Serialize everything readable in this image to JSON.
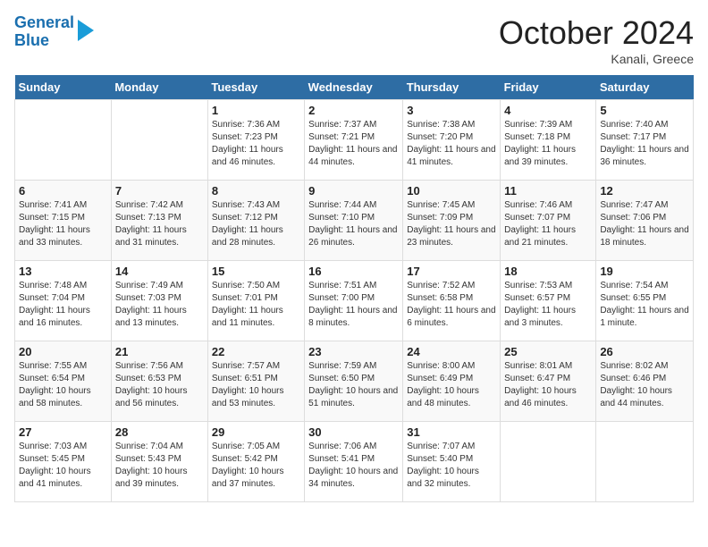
{
  "header": {
    "logo_line1": "General",
    "logo_line2": "Blue",
    "month": "October 2024",
    "location": "Kanali, Greece"
  },
  "weekdays": [
    "Sunday",
    "Monday",
    "Tuesday",
    "Wednesday",
    "Thursday",
    "Friday",
    "Saturday"
  ],
  "weeks": [
    [
      {
        "day": "",
        "info": ""
      },
      {
        "day": "",
        "info": ""
      },
      {
        "day": "1",
        "info": "Sunrise: 7:36 AM\nSunset: 7:23 PM\nDaylight: 11 hours and 46 minutes."
      },
      {
        "day": "2",
        "info": "Sunrise: 7:37 AM\nSunset: 7:21 PM\nDaylight: 11 hours and 44 minutes."
      },
      {
        "day": "3",
        "info": "Sunrise: 7:38 AM\nSunset: 7:20 PM\nDaylight: 11 hours and 41 minutes."
      },
      {
        "day": "4",
        "info": "Sunrise: 7:39 AM\nSunset: 7:18 PM\nDaylight: 11 hours and 39 minutes."
      },
      {
        "day": "5",
        "info": "Sunrise: 7:40 AM\nSunset: 7:17 PM\nDaylight: 11 hours and 36 minutes."
      }
    ],
    [
      {
        "day": "6",
        "info": "Sunrise: 7:41 AM\nSunset: 7:15 PM\nDaylight: 11 hours and 33 minutes."
      },
      {
        "day": "7",
        "info": "Sunrise: 7:42 AM\nSunset: 7:13 PM\nDaylight: 11 hours and 31 minutes."
      },
      {
        "day": "8",
        "info": "Sunrise: 7:43 AM\nSunset: 7:12 PM\nDaylight: 11 hours and 28 minutes."
      },
      {
        "day": "9",
        "info": "Sunrise: 7:44 AM\nSunset: 7:10 PM\nDaylight: 11 hours and 26 minutes."
      },
      {
        "day": "10",
        "info": "Sunrise: 7:45 AM\nSunset: 7:09 PM\nDaylight: 11 hours and 23 minutes."
      },
      {
        "day": "11",
        "info": "Sunrise: 7:46 AM\nSunset: 7:07 PM\nDaylight: 11 hours and 21 minutes."
      },
      {
        "day": "12",
        "info": "Sunrise: 7:47 AM\nSunset: 7:06 PM\nDaylight: 11 hours and 18 minutes."
      }
    ],
    [
      {
        "day": "13",
        "info": "Sunrise: 7:48 AM\nSunset: 7:04 PM\nDaylight: 11 hours and 16 minutes."
      },
      {
        "day": "14",
        "info": "Sunrise: 7:49 AM\nSunset: 7:03 PM\nDaylight: 11 hours and 13 minutes."
      },
      {
        "day": "15",
        "info": "Sunrise: 7:50 AM\nSunset: 7:01 PM\nDaylight: 11 hours and 11 minutes."
      },
      {
        "day": "16",
        "info": "Sunrise: 7:51 AM\nSunset: 7:00 PM\nDaylight: 11 hours and 8 minutes."
      },
      {
        "day": "17",
        "info": "Sunrise: 7:52 AM\nSunset: 6:58 PM\nDaylight: 11 hours and 6 minutes."
      },
      {
        "day": "18",
        "info": "Sunrise: 7:53 AM\nSunset: 6:57 PM\nDaylight: 11 hours and 3 minutes."
      },
      {
        "day": "19",
        "info": "Sunrise: 7:54 AM\nSunset: 6:55 PM\nDaylight: 11 hours and 1 minute."
      }
    ],
    [
      {
        "day": "20",
        "info": "Sunrise: 7:55 AM\nSunset: 6:54 PM\nDaylight: 10 hours and 58 minutes."
      },
      {
        "day": "21",
        "info": "Sunrise: 7:56 AM\nSunset: 6:53 PM\nDaylight: 10 hours and 56 minutes."
      },
      {
        "day": "22",
        "info": "Sunrise: 7:57 AM\nSunset: 6:51 PM\nDaylight: 10 hours and 53 minutes."
      },
      {
        "day": "23",
        "info": "Sunrise: 7:59 AM\nSunset: 6:50 PM\nDaylight: 10 hours and 51 minutes."
      },
      {
        "day": "24",
        "info": "Sunrise: 8:00 AM\nSunset: 6:49 PM\nDaylight: 10 hours and 48 minutes."
      },
      {
        "day": "25",
        "info": "Sunrise: 8:01 AM\nSunset: 6:47 PM\nDaylight: 10 hours and 46 minutes."
      },
      {
        "day": "26",
        "info": "Sunrise: 8:02 AM\nSunset: 6:46 PM\nDaylight: 10 hours and 44 minutes."
      }
    ],
    [
      {
        "day": "27",
        "info": "Sunrise: 7:03 AM\nSunset: 5:45 PM\nDaylight: 10 hours and 41 minutes."
      },
      {
        "day": "28",
        "info": "Sunrise: 7:04 AM\nSunset: 5:43 PM\nDaylight: 10 hours and 39 minutes."
      },
      {
        "day": "29",
        "info": "Sunrise: 7:05 AM\nSunset: 5:42 PM\nDaylight: 10 hours and 37 minutes."
      },
      {
        "day": "30",
        "info": "Sunrise: 7:06 AM\nSunset: 5:41 PM\nDaylight: 10 hours and 34 minutes."
      },
      {
        "day": "31",
        "info": "Sunrise: 7:07 AM\nSunset: 5:40 PM\nDaylight: 10 hours and 32 minutes."
      },
      {
        "day": "",
        "info": ""
      },
      {
        "day": "",
        "info": ""
      }
    ]
  ]
}
